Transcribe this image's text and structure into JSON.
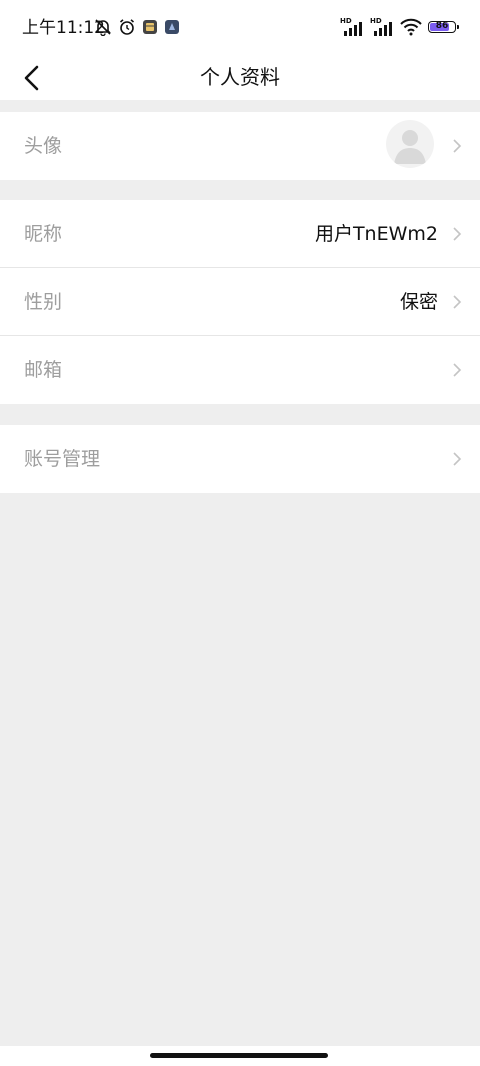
{
  "status_bar": {
    "time": "上午11:12",
    "battery_level": "86",
    "battery_color": "#7b5cf0",
    "signal_label": "HD"
  },
  "nav": {
    "title": "个人资料"
  },
  "rows": [
    {
      "label": "头像"
    },
    {
      "label": "昵称",
      "value": "用户TnEWm2"
    },
    {
      "label": "性别",
      "value": "保密"
    },
    {
      "label": "邮箱",
      "value": ""
    },
    {
      "label": "账号管理"
    }
  ],
  "colors": {
    "background": "#eeeeee",
    "card": "#ffffff",
    "label": "#9e9e9e",
    "value": "#111111"
  }
}
